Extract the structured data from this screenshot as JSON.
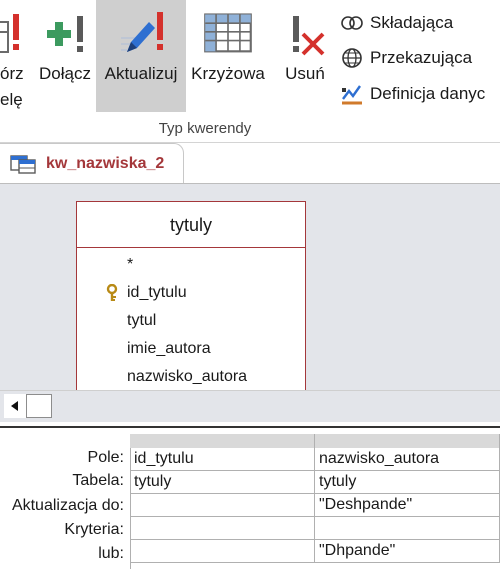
{
  "ribbon": {
    "buttons": [
      {
        "line1": "órz",
        "line2": "elę"
      },
      {
        "line1": "Dołącz"
      },
      {
        "line1": "Aktualizuj"
      },
      {
        "line1": "Krzyżowa"
      },
      {
        "line1": "Usuń"
      }
    ],
    "small_commands": [
      "Składająca",
      "Przekazująca",
      "Definicja danyc"
    ],
    "group_label": "Typ kwerendy"
  },
  "document_tab": {
    "title": "kw_nazwiska_2"
  },
  "table": {
    "name": "tytuly",
    "fields": [
      "*",
      "id_tytulu",
      "tytul",
      "imie_autora",
      "nazwisko_autora"
    ]
  },
  "grid": {
    "row_labels": [
      "Pole:",
      "Tabela:",
      "Aktualizacja do:",
      "Kryteria:",
      "lub:"
    ],
    "columns": [
      {
        "pole": "id_tytulu",
        "tabela": "tytuly",
        "aktualizacja": "",
        "kryteria": "",
        "lub": ""
      },
      {
        "pole": "nazwisko_autora",
        "tabela": "tytuly",
        "aktualizacja": "\"Deshpande\"",
        "kryteria": "",
        "lub": "\"Dhpande\""
      }
    ]
  },
  "colors": {
    "accent": "#a4373a",
    "active_button": "#cfcfcf",
    "surface": "#e3e5ea"
  }
}
